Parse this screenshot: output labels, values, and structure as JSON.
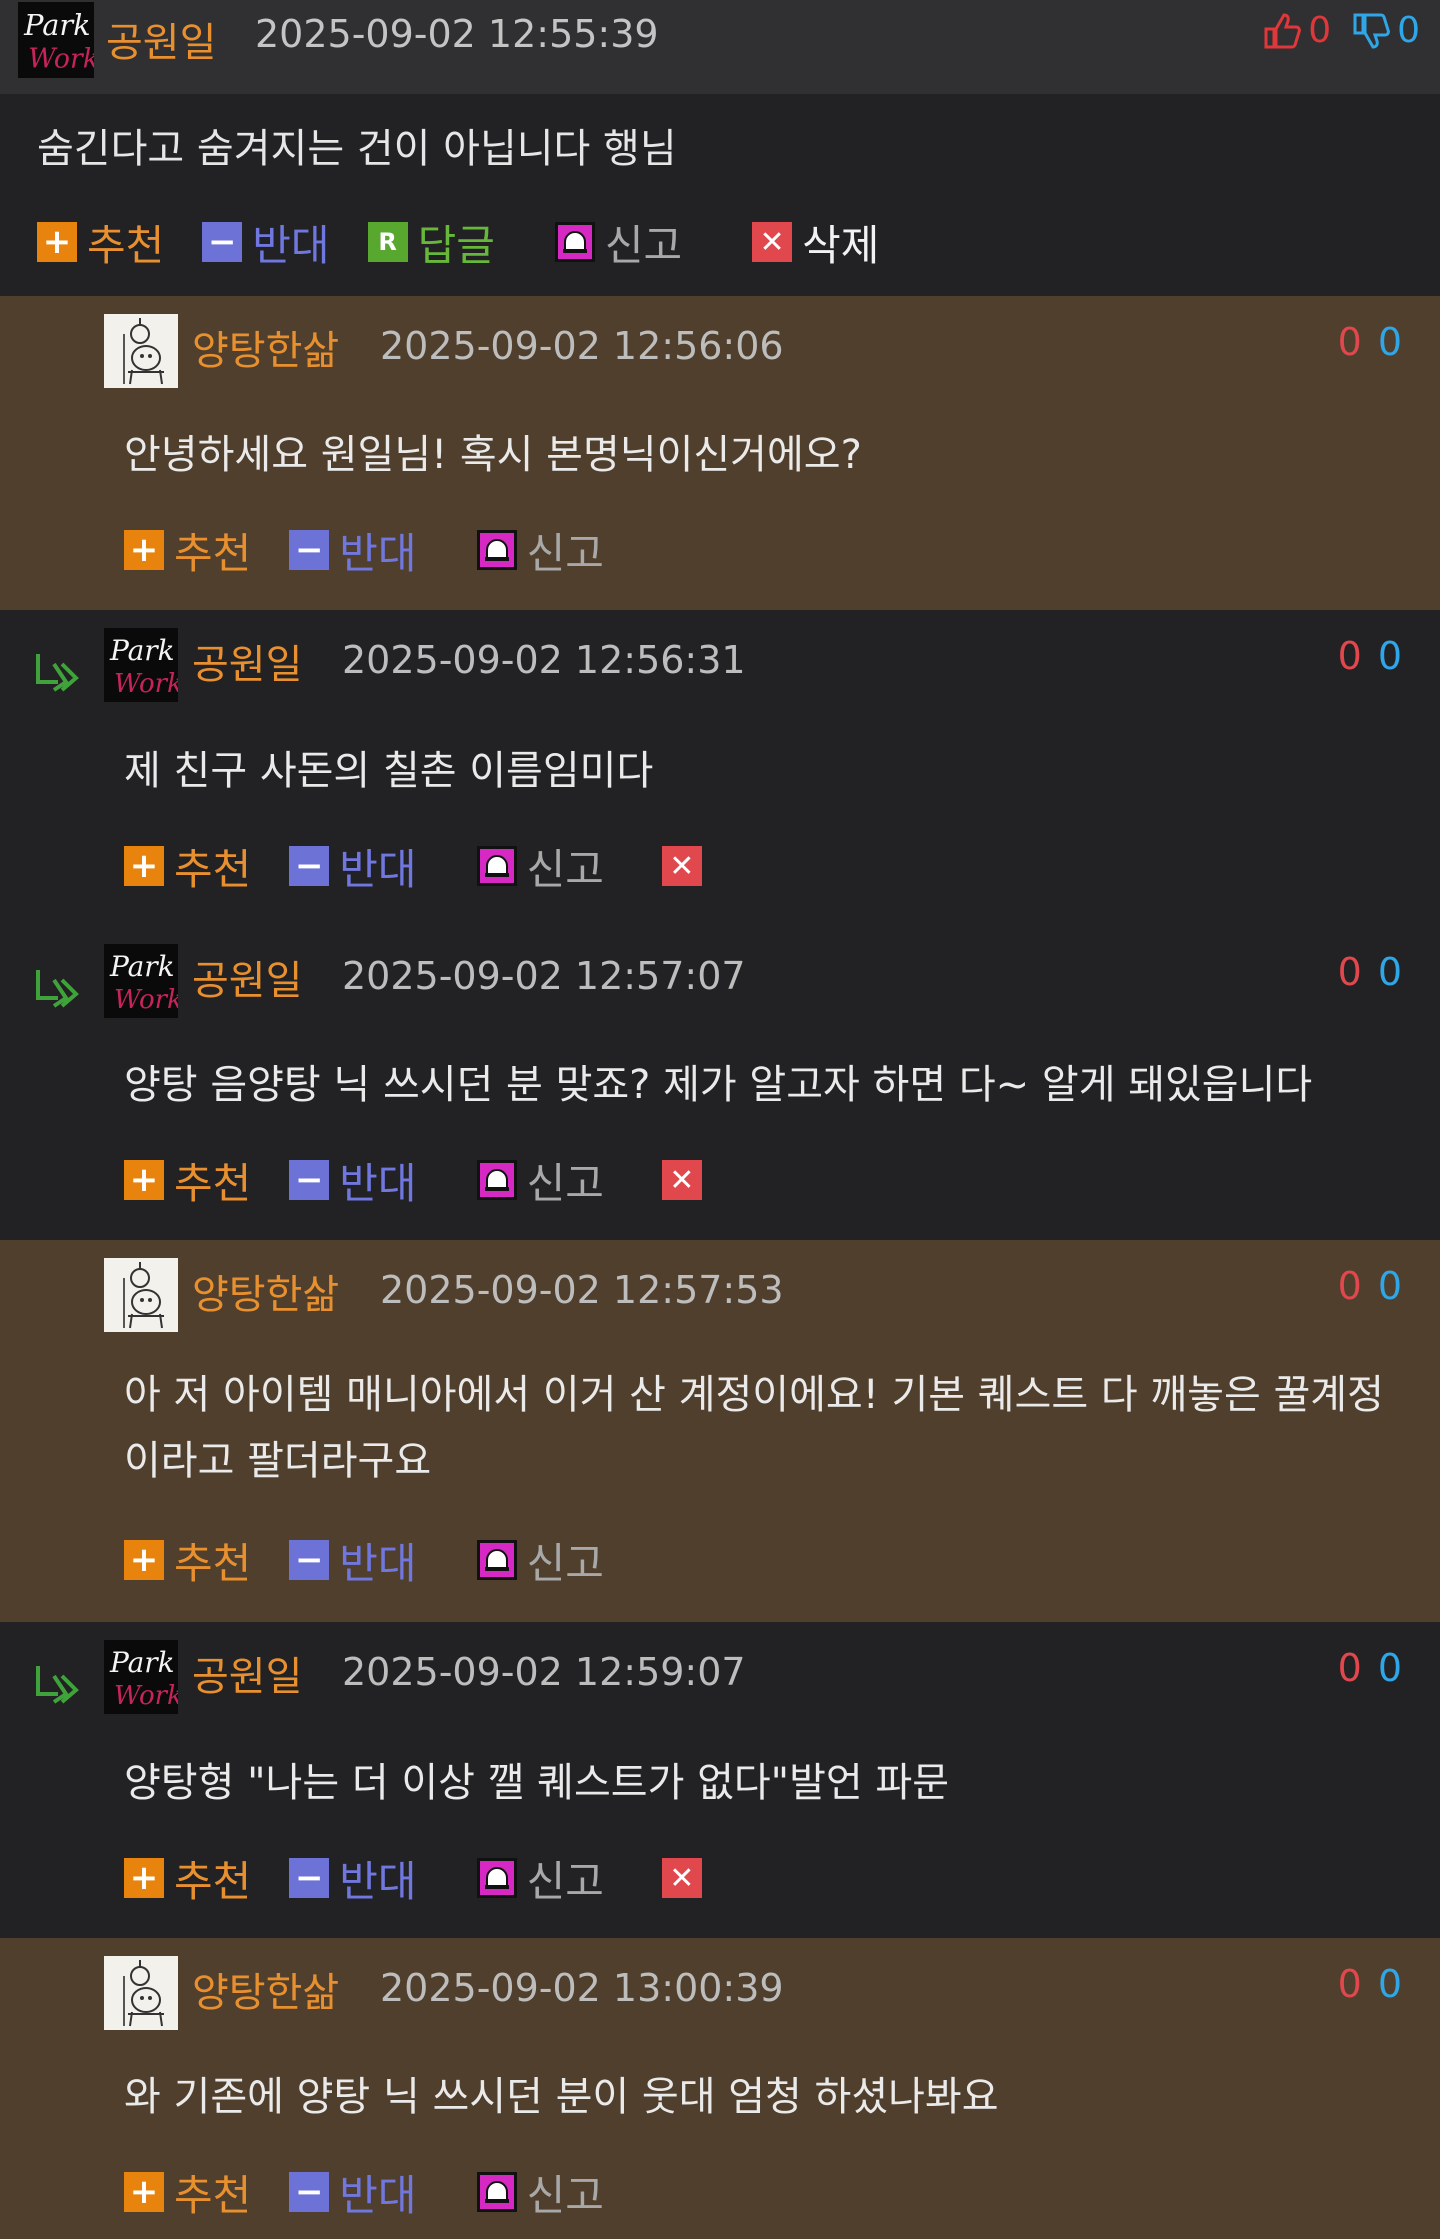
{
  "main": {
    "nick": "공원일",
    "date": "2025-09-02 12:55:39",
    "up_count": "0",
    "down_count": "0",
    "text": "숨긴다고 숨겨지는 건이 아닙니다 행님",
    "actions": {
      "recommend": "추천",
      "oppose": "반대",
      "reply": "답글",
      "report": "신고",
      "delete": "삭제"
    }
  },
  "avatar_text": {
    "park": "Park",
    "work": "Work"
  },
  "labels": {
    "recommend": "추천",
    "oppose": "반대",
    "report": "신고"
  },
  "comments": [
    {
      "nick": "양탕한삶",
      "date": "2025-09-02 12:56:06",
      "up": "0",
      "down": "0",
      "text": "안녕하세요 원일님! 혹시 본명닉이신거에오?"
    },
    {
      "nick": "공원일",
      "date": "2025-09-02 12:56:31",
      "up": "0",
      "down": "0",
      "text": "제 친구 사돈의 칠촌 이름임미다"
    },
    {
      "nick": "공원일",
      "date": "2025-09-02 12:57:07",
      "up": "0",
      "down": "0",
      "text": "양탕 음양탕 닉 쓰시던 분 맞죠? 제가 알고자 하면 다~ 알게 돼있읍니다"
    },
    {
      "nick": "양탕한삶",
      "date": "2025-09-02 12:57:53",
      "up": "0",
      "down": "0",
      "text": "아 저 아이템 매니아에서 이거 산 계정이에요! 기본 퀘스트 다 깨놓은 꿀계정이라고 팔더라구요"
    },
    {
      "nick": "공원일",
      "date": "2025-09-02 12:59:07",
      "up": "0",
      "down": "0",
      "text": "양탕형 \"나는 더 이상 깰 퀘스트가 없다\"발언 파문"
    },
    {
      "nick": "양탕한삶",
      "date": "2025-09-02 13:00:39",
      "up": "0",
      "down": "0",
      "text": "와 기존에 양탕 닉 쓰시던 분이 웃대 엄청 하셨나봐요"
    }
  ],
  "colors": {
    "accent_orange": "#e8902f",
    "up_red": "#e0484d",
    "down_blue": "#2fa6e8",
    "brown_bg": "#4f3f2c",
    "dark_bg": "#222224"
  },
  "icons": [
    "thumbs-up-icon",
    "thumbs-down-icon",
    "plus-icon",
    "minus-icon",
    "reply-icon",
    "siren-icon",
    "close-icon",
    "reply-arrow-icon"
  ]
}
